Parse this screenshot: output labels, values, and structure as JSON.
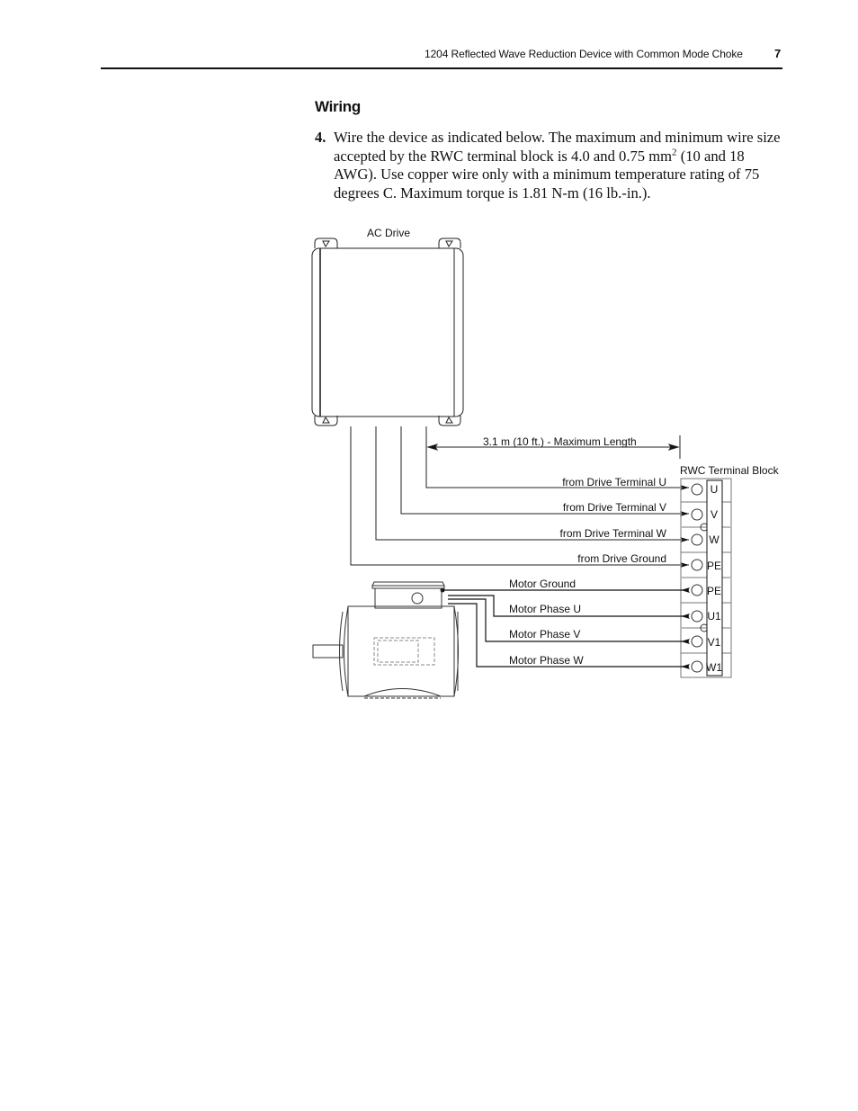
{
  "header": {
    "title": "1204 Reflected Wave Reduction Device with Common Mode Choke",
    "page_number": "7"
  },
  "section": {
    "title": "Wiring"
  },
  "step": {
    "number": "4.",
    "text_before_sup": "Wire the device as indicated below. The maximum and minimum wire size accepted by the RWC terminal block is 4.0 and 0.75 mm",
    "superscript": "2",
    "text_after_sup": " (10 and 18 AWG). Use copper wire only with a minimum temperature rating of 75 degrees C. Maximum torque is 1.81 N-m (16 lb.-in.)."
  },
  "diagram": {
    "drive_label": "AC Drive",
    "max_length_label": "3.1 m (10 ft.) - Maximum Length",
    "terminal_block_label": "RWC Terminal Block",
    "drive_wires": [
      {
        "label": "from Drive Terminal  U"
      },
      {
        "label": "from Drive Terminal  V"
      },
      {
        "label": "from Drive Terminal W"
      },
      {
        "label": "from Drive Ground"
      }
    ],
    "motor_wires": [
      {
        "label": "Motor Ground"
      },
      {
        "label": "Motor Phase U"
      },
      {
        "label": "Motor Phase V"
      },
      {
        "label": "Motor Phase W"
      }
    ],
    "terminals": [
      "U",
      "V",
      "W",
      "PE",
      "PE",
      "U1",
      "V1",
      "W1"
    ]
  }
}
